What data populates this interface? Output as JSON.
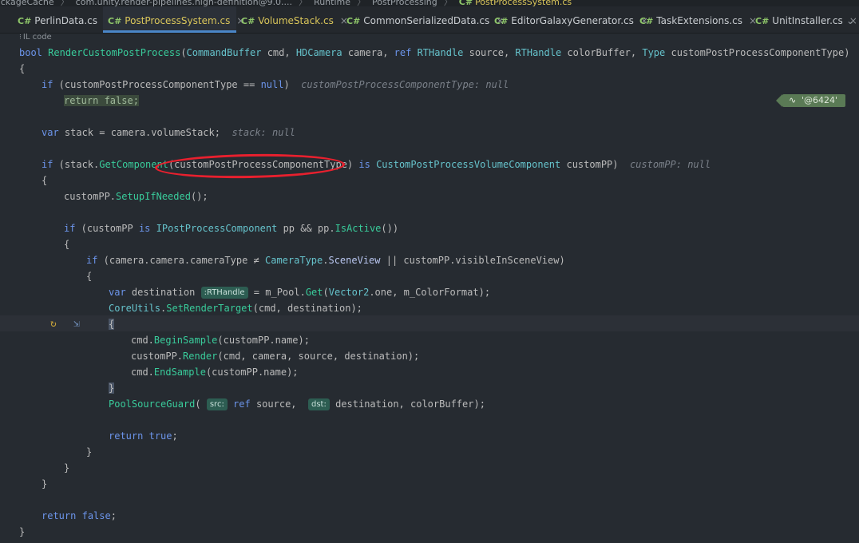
{
  "breadcrumb": {
    "items": [
      "ackageCache",
      "com.unity.render-pipelines.high-definition@9.0....",
      "Runtime",
      "PostProcessing"
    ],
    "lang_prefix": "C#",
    "current_file": "PostProcessSystem.cs"
  },
  "tabs": [
    {
      "lang": "C#",
      "label": "PerlinData.cs",
      "active": false
    },
    {
      "lang": "C#",
      "label": "PostProcessSystem.cs",
      "active": true
    },
    {
      "lang": "C#",
      "label": "VolumeStack.cs",
      "active": false
    },
    {
      "lang": "C#",
      "label": "CommonSerializedData.cs",
      "active": false
    },
    {
      "lang": "C#",
      "label": "EditorGalaxyGenerator.cs",
      "active": false
    },
    {
      "lang": "C#",
      "label": "TaskExtensions.cs",
      "active": false
    },
    {
      "lang": "C#",
      "label": "UnitInstaller.cs",
      "active": false
    }
  ],
  "tab_close_glyph": "×",
  "tab_overflow_glyph": "⌄",
  "code_lens": {
    "icon": "⁝",
    "label": "IL code"
  },
  "debug_value": {
    "icon": "∿",
    "text": "'@6424'"
  },
  "code": {
    "l1_kw": "bool",
    "l1_fn": "RenderCustomPostProcess",
    "l1_t1": "CommandBuffer",
    "l1_p1": " cmd, ",
    "l1_t2": "HDCamera",
    "l1_p2": " camera, ",
    "l1_kw2": "ref",
    "l1_t3": "RTHandle",
    "l1_p3": " source, ",
    "l1_t4": "RTHandle",
    "l1_p4": " colorBuffer, ",
    "l1_t5": "Type",
    "l1_p5": " customPostProcessComponentType)",
    "l2": "{",
    "l3_kw": "if",
    "l3_a": " (customPostProcessComponentType ",
    "l3_op": "==",
    "l3_null": "null",
    "l3_b": ")",
    "l3_hint": "customPostProcessComponentType: null",
    "l4": "return false;",
    "l5_kw": "var",
    "l5_a": " stack = camera.volumeStack;",
    "l5_hint": "stack: null",
    "l6_kw": "if",
    "l6_a": " (stack.",
    "l6_fn": "GetComponent",
    "l6_b": "(customPostProcessComponentType) ",
    "l6_kw2": "is",
    "l6_t": "CustomPostProcessVolumeComponent",
    "l6_c": " customPP)",
    "l6_hint": "customPP: null",
    "l7": "{",
    "l8_a": "customPP.",
    "l8_fn": "SetupIfNeeded",
    "l8_b": "();",
    "l9_kw": "if",
    "l9_a": " (customPP ",
    "l9_kw2": "is",
    "l9_t": "IPostProcessComponent",
    "l9_b": " pp && pp.",
    "l9_fn": "IsActive",
    "l9_c": "())",
    "l10": "{",
    "l11_kw": "if",
    "l11_a": " (camera.camera.cameraType ",
    "l11_op": "≠",
    "l11_t": "CameraType",
    "l11_b": ".",
    "l11_c": "SceneView",
    "l11_d": " || customPP.visibleInSceneView)",
    "l12": "{",
    "l13_kw": "var",
    "l13_a": " destination ",
    "l13_badge": ":RTHandle",
    "l13_b": " = m_Pool.",
    "l13_fn": "Get",
    "l13_c": "(",
    "l13_t": "Vector2",
    "l13_d": ".one, m_ColorFormat);",
    "l14_t": "CoreUtils",
    "l14_a": ".",
    "l14_fn": "SetRenderTarget",
    "l14_b": "(cmd, destination);",
    "l15": "{",
    "l16_a": "cmd.",
    "l16_fn": "BeginSample",
    "l16_b": "(customPP.name);",
    "l17_a": "customPP.",
    "l17_fn": "Render",
    "l17_b": "(cmd, camera, source, destination);",
    "l18_a": "cmd.",
    "l18_fn": "EndSample",
    "l18_b": "(customPP.name);",
    "l19": "}",
    "l20_fn": "PoolSourceGuard",
    "l20_a": "(",
    "l20_badge1": "src:",
    "l20_kw": "ref",
    "l20_b": " source,",
    "l20_badge2": "dst:",
    "l20_c": "destination, colorBuffer);",
    "l21_kw": "return",
    "l21_kw2": "true",
    "l21_a": ";",
    "l22": "}",
    "l23": "}",
    "l24_kw": "return",
    "l24_kw2": "false",
    "l24_a": ";",
    "l25": "}"
  },
  "gutter": {
    "icon1": "↻",
    "icon2": "⇲"
  }
}
